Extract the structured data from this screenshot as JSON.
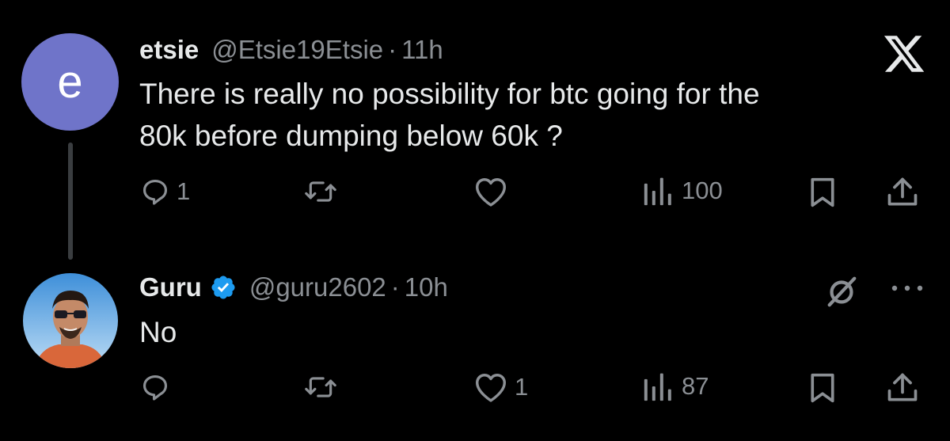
{
  "tweets": [
    {
      "avatar_letter": "e",
      "name": "etsie",
      "handle": "@Etsie19Etsie",
      "separator": "·",
      "time": "11h",
      "text_lines": [
        "There is really no possibility for btc going for the",
        "80k before dumping below 60k ?"
      ],
      "actions": {
        "replies": "1",
        "retweets": "",
        "likes": "",
        "views": "100"
      }
    },
    {
      "name": "Guru",
      "verified": true,
      "handle": "@guru2602",
      "separator": "·",
      "time": "10h",
      "text_lines": [
        "No"
      ],
      "actions": {
        "replies": "",
        "retweets": "",
        "likes": "1",
        "views": "87"
      }
    }
  ],
  "icons": {
    "brand": "x-logo-icon",
    "reply": "speech-bubble-icon",
    "retweet": "retweet-arrows-icon",
    "like": "heart-icon",
    "views": "bar-chart-icon",
    "bookmark": "bookmark-icon",
    "share": "share-upload-icon",
    "grok": "grok-slash-circle-icon",
    "more": "more-dots-icon"
  },
  "colors": {
    "background": "#000000",
    "text_primary": "#e7e9ea",
    "text_secondary": "#8b8f94",
    "avatar_letter_bg": "#6f74c9",
    "verified_blue": "#1d9bf0",
    "thread_line": "#3a3d40"
  }
}
